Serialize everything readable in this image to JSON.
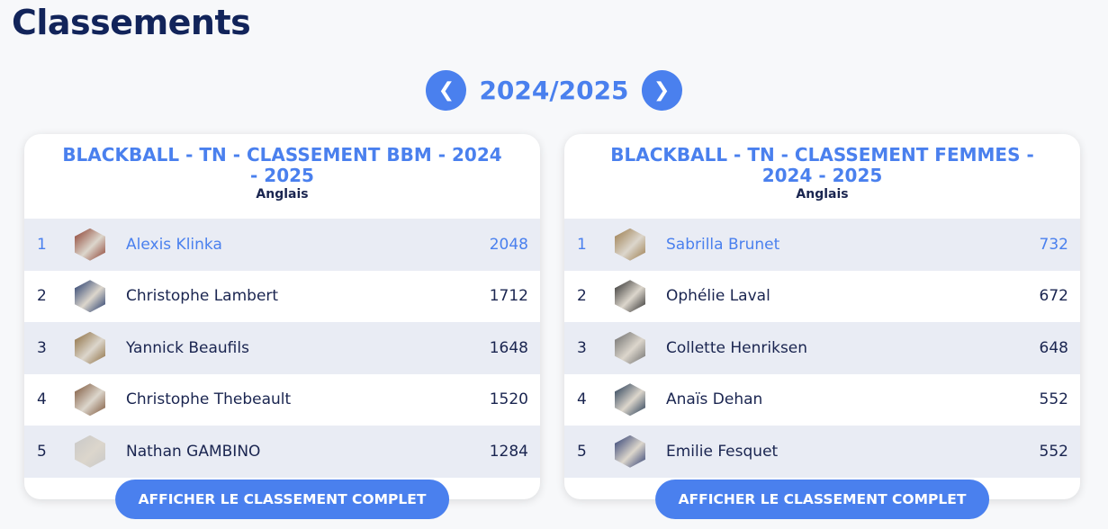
{
  "page": {
    "title": "Classements"
  },
  "season": {
    "label": "2024/2025",
    "prev_glyph": "❮",
    "next_glyph": "❯"
  },
  "colors": {
    "accent": "#4a80ee",
    "navy": "#12245a",
    "row_alt": "#e9ecf4"
  },
  "rankings": [
    {
      "title": "BLACKBALL - TN - CLASSEMENT BBM - 2024 - 2025",
      "subtitle": "Anglais",
      "cta": "AFFICHER LE CLASSEMENT COMPLET",
      "rows": [
        {
          "rank": "1",
          "name": "Alexis Klinka",
          "points": "2048",
          "avatar_color": "#8a3b2c"
        },
        {
          "rank": "2",
          "name": "Christophe Lambert",
          "points": "1712",
          "avatar_color": "#1d3468"
        },
        {
          "rank": "3",
          "name": "Yannick Beaufils",
          "points": "1648",
          "avatar_color": "#8a6a3c"
        },
        {
          "rank": "4",
          "name": "Christophe Thebeault",
          "points": "1520",
          "avatar_color": "#7a5236"
        },
        {
          "rank": "5",
          "name": "Nathan GAMBINO",
          "points": "1284",
          "avatar_color": "#c8c8c8"
        }
      ]
    },
    {
      "title": "BLACKBALL - TN - CLASSEMENT FEMMES - 2024 - 2025",
      "subtitle": "Anglais",
      "cta": "AFFICHER LE CLASSEMENT COMPLET",
      "rows": [
        {
          "rank": "1",
          "name": "Sabrilla Brunet",
          "points": "732",
          "avatar_color": "#9a7a4a"
        },
        {
          "rank": "2",
          "name": "Ophélie Laval",
          "points": "672",
          "avatar_color": "#2a2a2a"
        },
        {
          "rank": "3",
          "name": "Collette Henriksen",
          "points": "648",
          "avatar_color": "#6a6a6a"
        },
        {
          "rank": "4",
          "name": "Anaïs Dehan",
          "points": "552",
          "avatar_color": "#1f3550"
        },
        {
          "rank": "5",
          "name": "Emilie Fesquet",
          "points": "552",
          "avatar_color": "#2a3a70"
        }
      ]
    }
  ]
}
